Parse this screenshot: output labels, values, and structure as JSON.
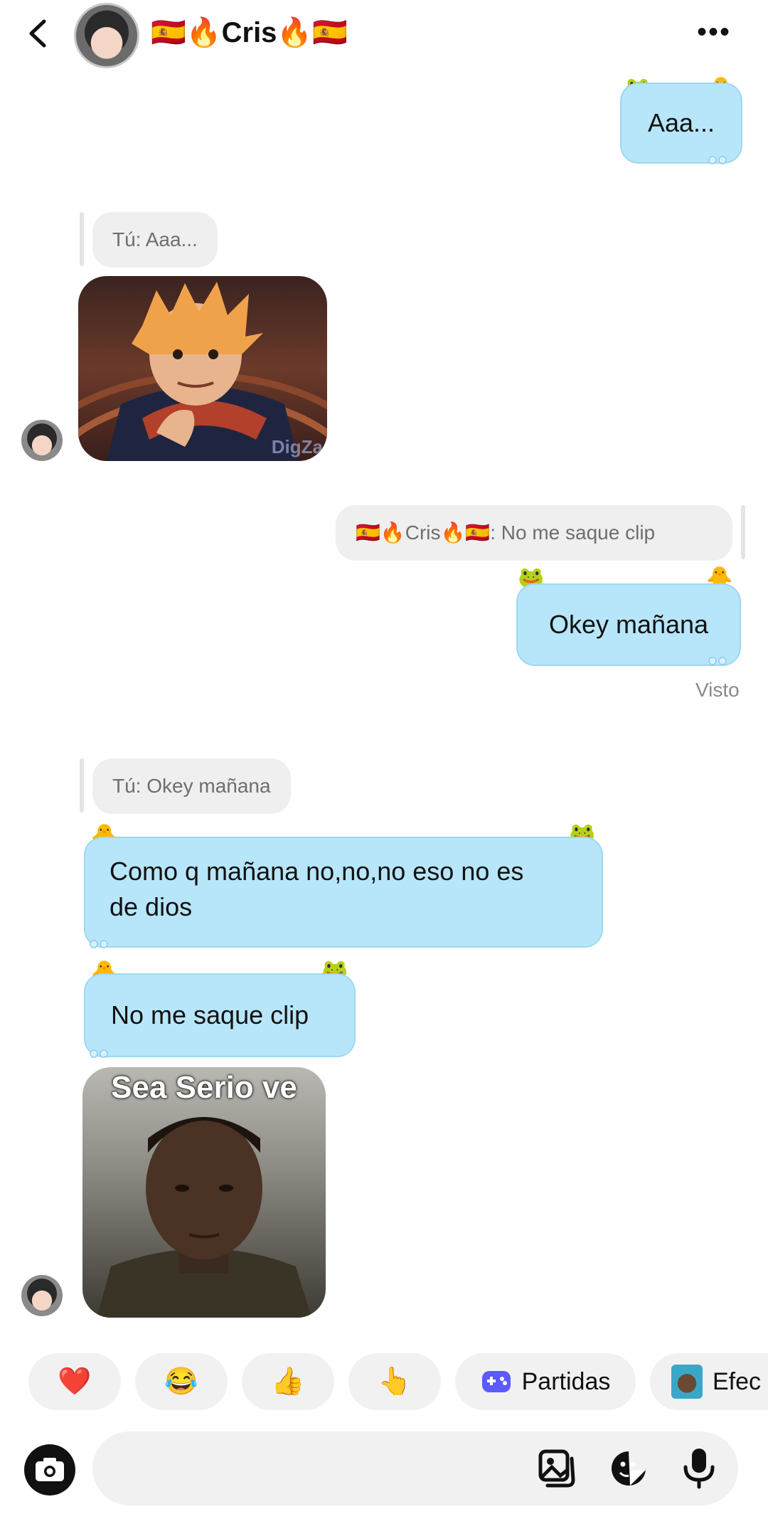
{
  "header": {
    "name": "🇪🇸🔥Cris🔥🇪🇸",
    "more_label": "•••"
  },
  "messages": {
    "m1_text": "Aaa...",
    "reply1": "Tú: Aaa...",
    "image1_watermark": "DigZa",
    "reply2": "🇪🇸🔥Cris🔥🇪🇸: No me saque clip",
    "m2_text": "Okey mañana",
    "seen": "Visto",
    "reply3": "Tú: Okey mañana",
    "m3_line1": "Como q mañana no,no,no eso no es",
    "m3_line2": "de dios",
    "m4_text": "No me saque clip",
    "image2_caption": "Sea Serio ve"
  },
  "quick_reactions": {
    "heart": "❤️",
    "laugh": "😂",
    "thumbs": "👍",
    "point": "👆",
    "partidas": "Partidas",
    "efectos": "Efec"
  },
  "icons": {
    "back": "chevron-left-icon",
    "more": "more-horizontal-icon",
    "camera": "camera-icon",
    "gallery": "gallery-icon",
    "sticker": "sticker-icon",
    "mic": "microphone-icon",
    "game": "game-controller-icon"
  },
  "colors": {
    "bubble_blue": "#b7e6fb",
    "chip_gray": "#f1f1f1",
    "heart_red": "#e41e3f",
    "game_purple": "#5b5bff"
  }
}
